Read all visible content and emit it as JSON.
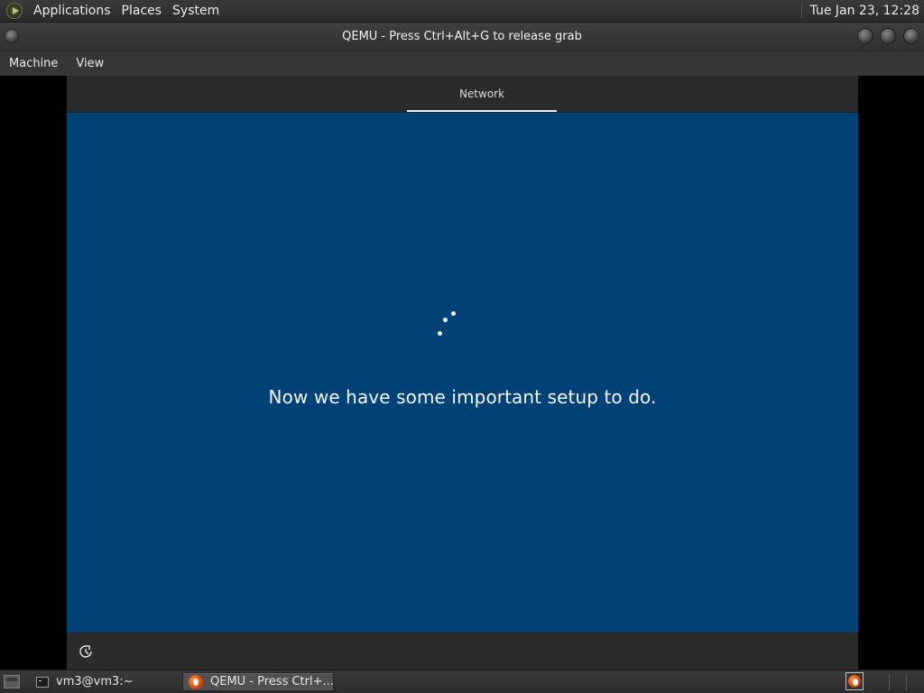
{
  "top_panel": {
    "menus": [
      "Applications",
      "Places",
      "System"
    ],
    "clock": "Tue Jan 23, 12:28"
  },
  "window": {
    "title": "QEMU - Press Ctrl+Alt+G to release grab",
    "menus": [
      "Machine",
      "View"
    ]
  },
  "vm": {
    "header_tab": "Network",
    "message": "Now we have some important setup to do.",
    "background_color": "#004275",
    "footer_icon": "ease-of-access-icon"
  },
  "taskbar": {
    "items": [
      {
        "label": "vm3@vm3:~",
        "icon": "terminal-icon"
      },
      {
        "label": "QEMU - Press Ctrl+...",
        "icon": "qemu-icon",
        "active": true
      }
    ],
    "tray_icon": "qemu-icon"
  }
}
